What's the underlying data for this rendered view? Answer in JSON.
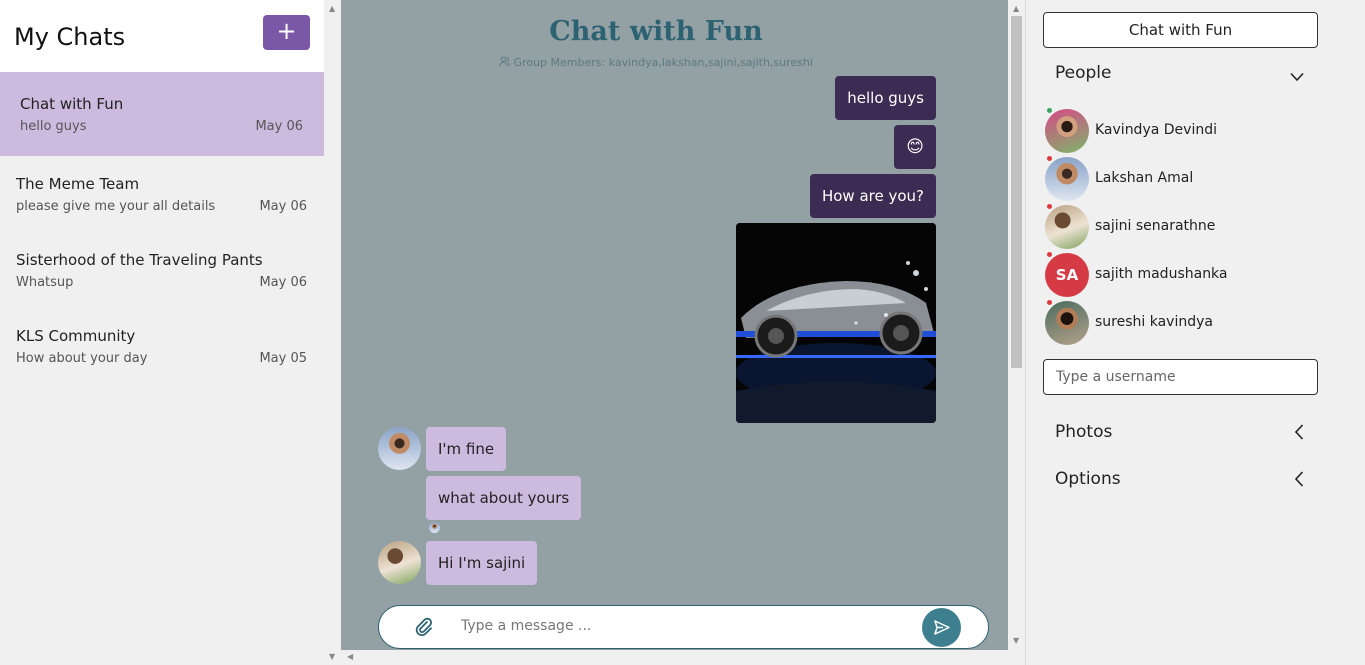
{
  "sidebar": {
    "title": "My Chats",
    "new_chat_label": "+",
    "chats": [
      {
        "name": "Chat with Fun",
        "preview": "hello guys",
        "date": "May 06",
        "active": true
      },
      {
        "name": "The Meme Team",
        "preview": "please give me your all details",
        "date": "May 06",
        "active": false
      },
      {
        "name": "Sisterhood of the Traveling Pants",
        "preview": "Whatsup",
        "date": "May 06",
        "active": false
      },
      {
        "name": "KLS Community",
        "preview": "How about your day",
        "date": "May 05",
        "active": false
      }
    ]
  },
  "conversation": {
    "title": "Chat with Fun",
    "members": "Group Members: kavindya,lakshan,sajini,sajith,sureshi",
    "messages": [
      {
        "text": "hello guys",
        "direction": "out"
      },
      {
        "text": "😊",
        "direction": "out"
      },
      {
        "text": "How are you?",
        "direction": "out"
      },
      {
        "type": "image",
        "image": "car-photo",
        "direction": "out"
      },
      {
        "text": "I'm fine",
        "direction": "in",
        "sender": "Lakshan Amal"
      },
      {
        "text": "what about yours",
        "direction": "in",
        "sender": "Lakshan Amal"
      },
      {
        "text": "Hi I'm sajini",
        "direction": "in",
        "sender": "sajini senarathne"
      }
    ],
    "composer": {
      "placeholder": "Type a message ...",
      "value": ""
    }
  },
  "details": {
    "group_name": "Chat with Fun",
    "people_label": "People",
    "people": [
      {
        "name": "Kavindya Devindi",
        "online": true
      },
      {
        "name": "Lakshan Amal",
        "online": false
      },
      {
        "name": "sajini senarathne",
        "online": false
      },
      {
        "name": "sajith madushanka",
        "initials": "SA",
        "online": false
      },
      {
        "name": "sureshi kavindya",
        "online": false
      }
    ],
    "username_placeholder": "Type a username",
    "photos_label": "Photos",
    "options_label": "Options"
  },
  "colors": {
    "accent": "#7b57a8",
    "active_chat": "#cdbbdf",
    "chat_bg": "#93a0a4",
    "outgoing_bubble": "#3c2b52",
    "incoming_bubble": "#cdbbdf",
    "title": "#2d6272",
    "send_button": "#3d7f8f",
    "initials_avatar": "#d63b45",
    "online_dot": "#3aa55d",
    "offline_dot": "#e0393e"
  }
}
